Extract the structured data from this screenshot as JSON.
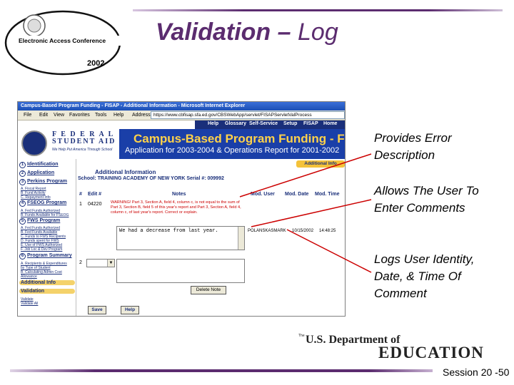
{
  "slide": {
    "title_part1": "Validation – ",
    "title_part2": "Log",
    "logo_text": "Electronic Access Conference",
    "logo_year": "2002",
    "session": "Session 20 -50",
    "footer_logo_the": "The",
    "footer_logo_line1": "U.S. Department of",
    "footer_logo_line2": "EDUCATION"
  },
  "callouts": [
    {
      "text": "Provides Error\nDescription"
    },
    {
      "text": "Allows The User To\nEnter Comments"
    },
    {
      "text": "Logs User Identity,\nDate, & Time Of\nComment"
    }
  ],
  "browser": {
    "window_title": "Campus-Based Program Funding - FISAP - Additional Information - Microsoft Internet Explorer",
    "menu": [
      "File",
      "Edit",
      "View",
      "Favorites",
      "Tools",
      "Help"
    ],
    "address_label": "Address",
    "address_url": "https://www.cbfisap.sfa.ed.gov/CBSWebApp/servlet/FISAPServletValProcess"
  },
  "site": {
    "nav": [
      "Help",
      "Glossary",
      "Self-Service",
      "Setup",
      "FISAP",
      "Home"
    ],
    "fsa_line1": "F E D E R A L",
    "fsa_line2": "STUDENT AID",
    "fsa_tagline": "We Help Put America Through School",
    "banner_title": "Campus-Based Program Funding - FISAP",
    "banner_subtitle": "Application for 2003-2004 & Operations Report for 2001-2002"
  },
  "sidebar": {
    "sections": [
      {
        "num": "1",
        "label": "Identification"
      },
      {
        "num": "2",
        "label": "Application"
      },
      {
        "num": "3",
        "label": "Perkins Program"
      },
      {
        "num": "4",
        "label": "FSEOG Program"
      },
      {
        "num": "5",
        "label": "FWS Program"
      },
      {
        "num": "6",
        "label": "Program Summary"
      }
    ],
    "perkins_items": [
      "A. Fiscal Report",
      "B. Fund Activity",
      "C. Repayment Info"
    ],
    "fseog_items": [
      "A. Fed Funds Authorized",
      "B. Funds Available for FSEOG"
    ],
    "fws_items": [
      "A. Fed Funds Authorized",
      "B. Fed Funds Available",
      "C. Funds to FWS Recipients",
      "D. Funds spent for FWS",
      "E. Use of FWS Authorized",
      "F. Job Loc & Dev Program"
    ],
    "summary_items": [
      "A. Recipients & Expenditures",
      "by Type of Student",
      "B. Calculating Admin Cost",
      "Allowance"
    ],
    "additional_info": "Additional Info",
    "validation": "Validation",
    "validation_items": [
      "Validate",
      "Validate All"
    ]
  },
  "main": {
    "tab": "Additional Info",
    "form_title": "Additional Information",
    "school": "School: TRAINING ACADEMY OF NEW YORK   Serial #: 009992",
    "columns": {
      "num": "#",
      "edit": "Edit #",
      "notes": "Notes",
      "mod_user": "Mod. User",
      "mod_date": "Mod. Date",
      "mod_time": "Mod. Time"
    },
    "row1": {
      "num": "1",
      "edit": "04220",
      "warning": "WARNING! Part 3, Section A, field 4, column c, is not equal to the sum of Part 3, Section B, field 5 of this year's report and Part 3, Section A, field 4, column c, of last year's report. Correct or explain.",
      "comment": "We had a decrease from last year.",
      "mod_user": "POLANSKASMARK",
      "mod_date": "10/15/2002",
      "mod_time": "14:48:25"
    },
    "row2": {
      "num": "2"
    },
    "delete_label": "Delete Note",
    "save_label": "Save",
    "help_label": "Help"
  }
}
